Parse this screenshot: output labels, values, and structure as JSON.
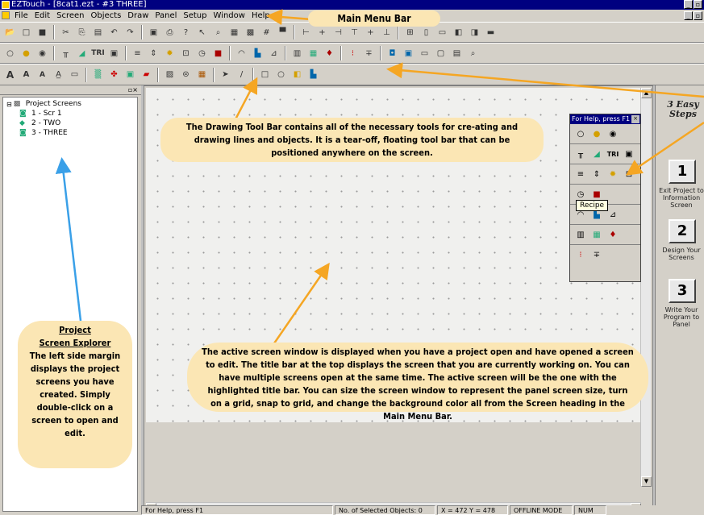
{
  "window": {
    "title": "EZTouch - [8cat1.ezt - #3 THREE]"
  },
  "menu": {
    "items": [
      "File",
      "Edit",
      "Screen",
      "Objects",
      "Draw",
      "Panel",
      "Setup",
      "Window",
      "Help"
    ]
  },
  "project_tree": {
    "root": "Project Screens",
    "items": [
      "1 - Scr 1",
      "2 - TWO",
      "3 - THREE"
    ]
  },
  "floating_toolbar": {
    "title": "For Help, press F1",
    "tooltip": "Recipe"
  },
  "steps": {
    "title": "3 Easy Steps",
    "items": [
      {
        "number": "1",
        "label": "Exit Project to Information Screen"
      },
      {
        "number": "2",
        "label": "Design Your Screens"
      },
      {
        "number": "3",
        "label": "Write Your Program to Panel"
      }
    ]
  },
  "status_bar": {
    "help": "For Help, press F1",
    "selected": "No. of Selected Objects: 0",
    "coords": "X = 472  Y = 478",
    "mode": "OFFLINE MODE",
    "num": "NUM"
  },
  "callouts": {
    "menu_bar": "Main Menu Bar",
    "drawing_toolbar": "The Drawing Tool Bar contains all of the necessary tools for cre-ating and drawing lines and objects. It is a tear-off, floating tool bar that can be positioned anywhere on the screen.",
    "active_screen": "The active screen window is displayed when you have a project open and have opened a screen to edit. The title bar at the top displays the screen that you are currently working on. You can have multiple screens open at the same time. The active screen will be the one with the highlighted title bar. You can size the screen window to represent the panel screen size, turn on a grid, snap to grid, and change the background color all from the Screen heading in the Main Menu Bar.",
    "project_heading_1": "Project",
    "project_heading_2": "Screen Explorer",
    "project_body": "The left side margin displays the project screens you have created. Simply double-click on a screen to open and edit."
  },
  "colors": {
    "callout": "#fbe6b4",
    "arrow": "#f5a623",
    "arrow_blue": "#3aa0e8",
    "titlebar": "#000080"
  }
}
